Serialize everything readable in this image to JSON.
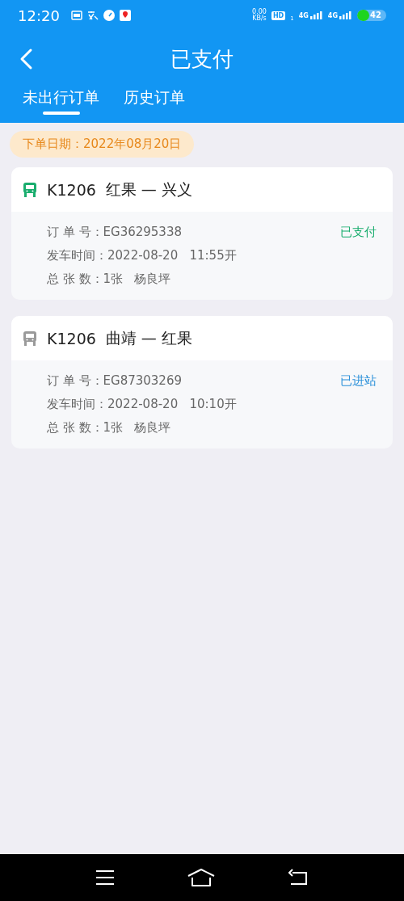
{
  "status_bar": {
    "time": "12:20",
    "speed": "0.00",
    "speed_unit": "KB/s",
    "hd": "HD",
    "sim_index": "1",
    "networks": [
      "4G",
      "4G"
    ],
    "battery": "42"
  },
  "header": {
    "title": "已支付"
  },
  "tabs": [
    {
      "label": "未出行订单",
      "selected": true
    },
    {
      "label": "历史订单",
      "selected": false
    }
  ],
  "order_date": "下单日期：2022年08月20日",
  "orders": [
    {
      "train": "K1206",
      "route": "红果 — 兴义",
      "active": true,
      "order_no": "订 单 号：EG36295338",
      "depart": "发车时间：2022-08-20   11:55开",
      "tickets": "总 张 数：1张   杨良坪",
      "status": "已支付",
      "color": "#1aad6e"
    },
    {
      "train": "K1206",
      "route": "曲靖 — 红果",
      "active": false,
      "order_no": "订 单 号：EG87303269",
      "depart": "发车时间：2022-08-20   10:10开",
      "tickets": "总 张 数：1张   杨良坪",
      "status": "已进站",
      "color": "#2b90d9"
    }
  ]
}
